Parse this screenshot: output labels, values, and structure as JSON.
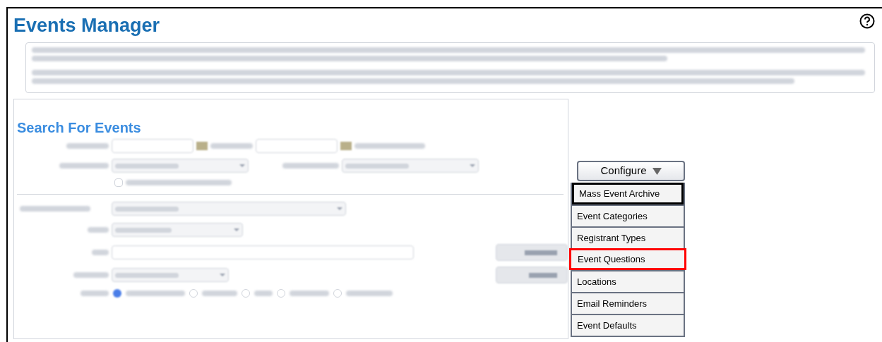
{
  "page": {
    "title": "Events Manager"
  },
  "search_panel": {
    "title": "Search For Events",
    "archived_checkbox": {
      "checked": false
    },
    "sort_options": [
      {
        "selected": true
      },
      {
        "selected": false
      },
      {
        "selected": false
      },
      {
        "selected": false
      },
      {
        "selected": false
      }
    ],
    "buttons": [
      {
        "kind": "search"
      },
      {
        "kind": "reset"
      }
    ]
  },
  "configure": {
    "label": "Configure",
    "expanded": true,
    "menu": [
      {
        "label": "Mass Event Archive",
        "focused": true,
        "highlighted": false
      },
      {
        "label": "Event Categories",
        "focused": false,
        "highlighted": false
      },
      {
        "label": "Registrant Types",
        "focused": false,
        "highlighted": false
      },
      {
        "label": "Event Questions",
        "focused": false,
        "highlighted": true
      },
      {
        "label": "Locations",
        "focused": false,
        "highlighted": false
      },
      {
        "label": "Email Reminders",
        "focused": false,
        "highlighted": false
      },
      {
        "label": "Event Defaults",
        "focused": false,
        "highlighted": false
      }
    ]
  }
}
